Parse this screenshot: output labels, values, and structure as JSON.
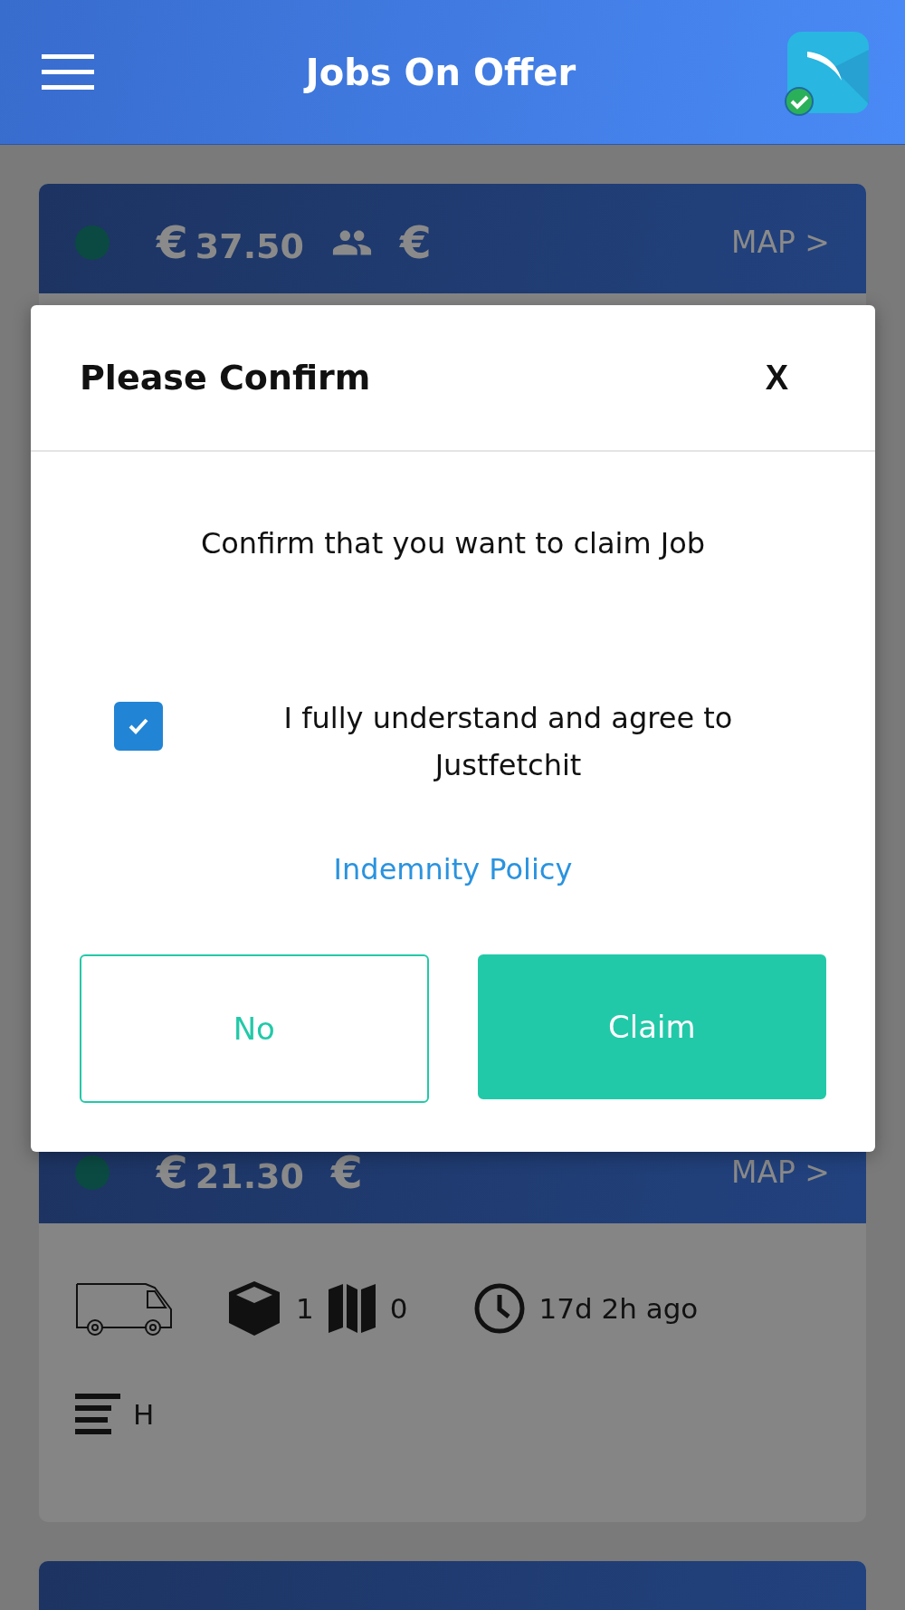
{
  "header": {
    "title": "Jobs On Offer",
    "avatar_verified": true
  },
  "jobs": [
    {
      "currency": "€",
      "amount": "37.50",
      "shared": true,
      "payment": "€",
      "map_link": "MAP >"
    },
    {
      "currency": "€",
      "amount": "21.30",
      "payment": "€",
      "map_link": "MAP >",
      "items": "1",
      "stops": "0",
      "posted": "17d 2h ago",
      "notes": "H"
    }
  ],
  "dialog": {
    "title": "Please Confirm",
    "close": "X",
    "message": "Confirm that you want to claim Job",
    "agreement": {
      "checked": true,
      "text": "I fully understand and agree to Justfetchit"
    },
    "link": "Indemnity Policy",
    "buttons": [
      {
        "label": "No",
        "kind": "outline"
      },
      {
        "label": "Claim",
        "kind": "filled"
      }
    ]
  }
}
